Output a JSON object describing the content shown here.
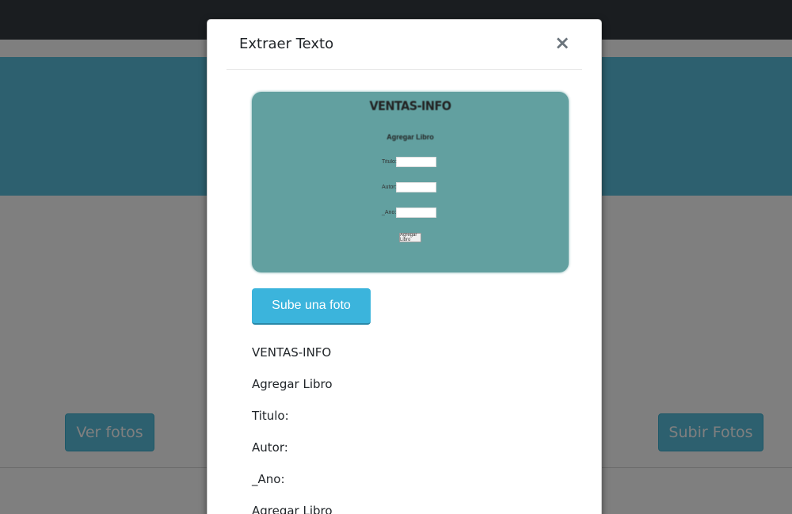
{
  "background": {
    "left_button": "Ver fotos",
    "right_button": "Subir Fotos"
  },
  "modal": {
    "title": "Extraer Texto",
    "close_label": "×",
    "preview": {
      "title": "VENTAS-INFO",
      "subtitle": "Agregar Libro",
      "fields": [
        "Titulo:",
        "Autor:",
        "_Ano:"
      ],
      "button": "Agregar Libro"
    },
    "upload_button": "Sube una foto",
    "extracted_lines": [
      "VENTAS-INFO",
      "Agregar Libro",
      "Titulo:",
      "Autor:",
      "_Ano:",
      "Agregar Libro"
    ]
  },
  "colors": {
    "navbar": "#343a40",
    "hero": "#5bc0de",
    "accent_button": "#3bb4dc",
    "preview_bg": "#62a0a0"
  }
}
